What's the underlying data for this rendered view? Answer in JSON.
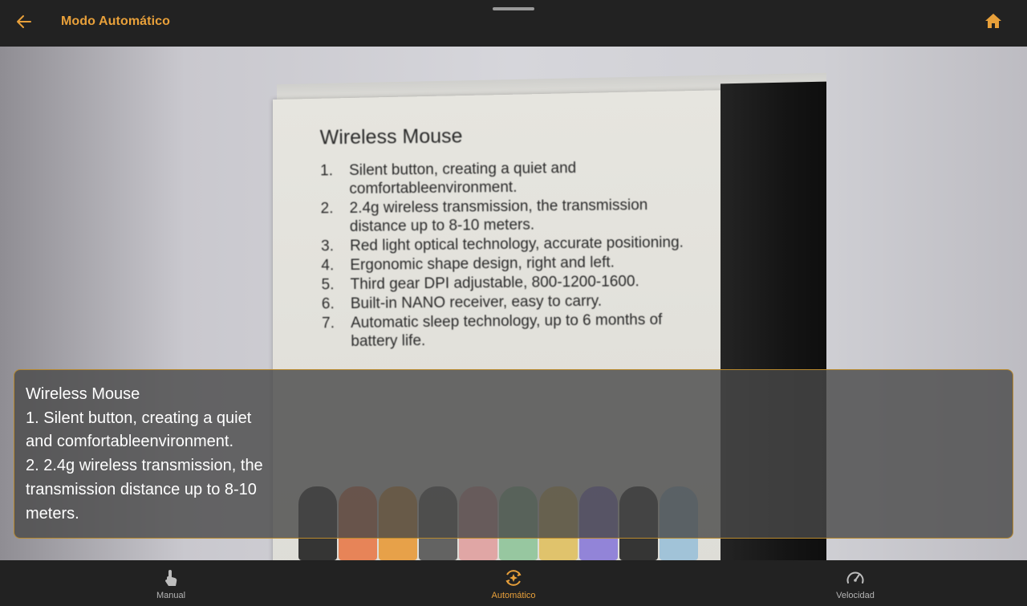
{
  "header": {
    "title": "Modo Automático",
    "back_icon": "arrow-back-icon",
    "home_icon": "home-icon",
    "accent_color": "#e8a03a"
  },
  "camera": {
    "box_title": "Wireless Mouse",
    "box_items": [
      {
        "num": "1.",
        "text": "Silent button, creating a quiet and comfortableenvironment."
      },
      {
        "num": "2.",
        "text": "2.4g wireless transmission, the transmission distance up to 8-10 meters."
      },
      {
        "num": "3.",
        "text": "Red light optical technology, accurate positioning."
      },
      {
        "num": "4.",
        "text": "Ergonomic shape design, right and left."
      },
      {
        "num": "5.",
        "text": "Third gear DPI adjustable, 800-1200-1600."
      },
      {
        "num": "6.",
        "text": "Built-in NANO receiver, easy to carry."
      },
      {
        "num": "7.",
        "text": "Automatic sleep technology, up to 6 months of battery life."
      }
    ]
  },
  "ocr": {
    "lines": [
      "Wireless Mouse",
      "1. Silent button, creating a quiet",
      "and comfortableenvironment.",
      "2. 2.4g wireless transmission, the",
      "transmission distance up to 8-10",
      "meters."
    ]
  },
  "nav": {
    "items": [
      {
        "label": "Manual",
        "icon": "touch-icon",
        "active": false
      },
      {
        "label": "Automático",
        "icon": "auto-scan-icon",
        "active": true
      },
      {
        "label": "Velocidad",
        "icon": "speedometer-icon",
        "active": false
      }
    ]
  }
}
